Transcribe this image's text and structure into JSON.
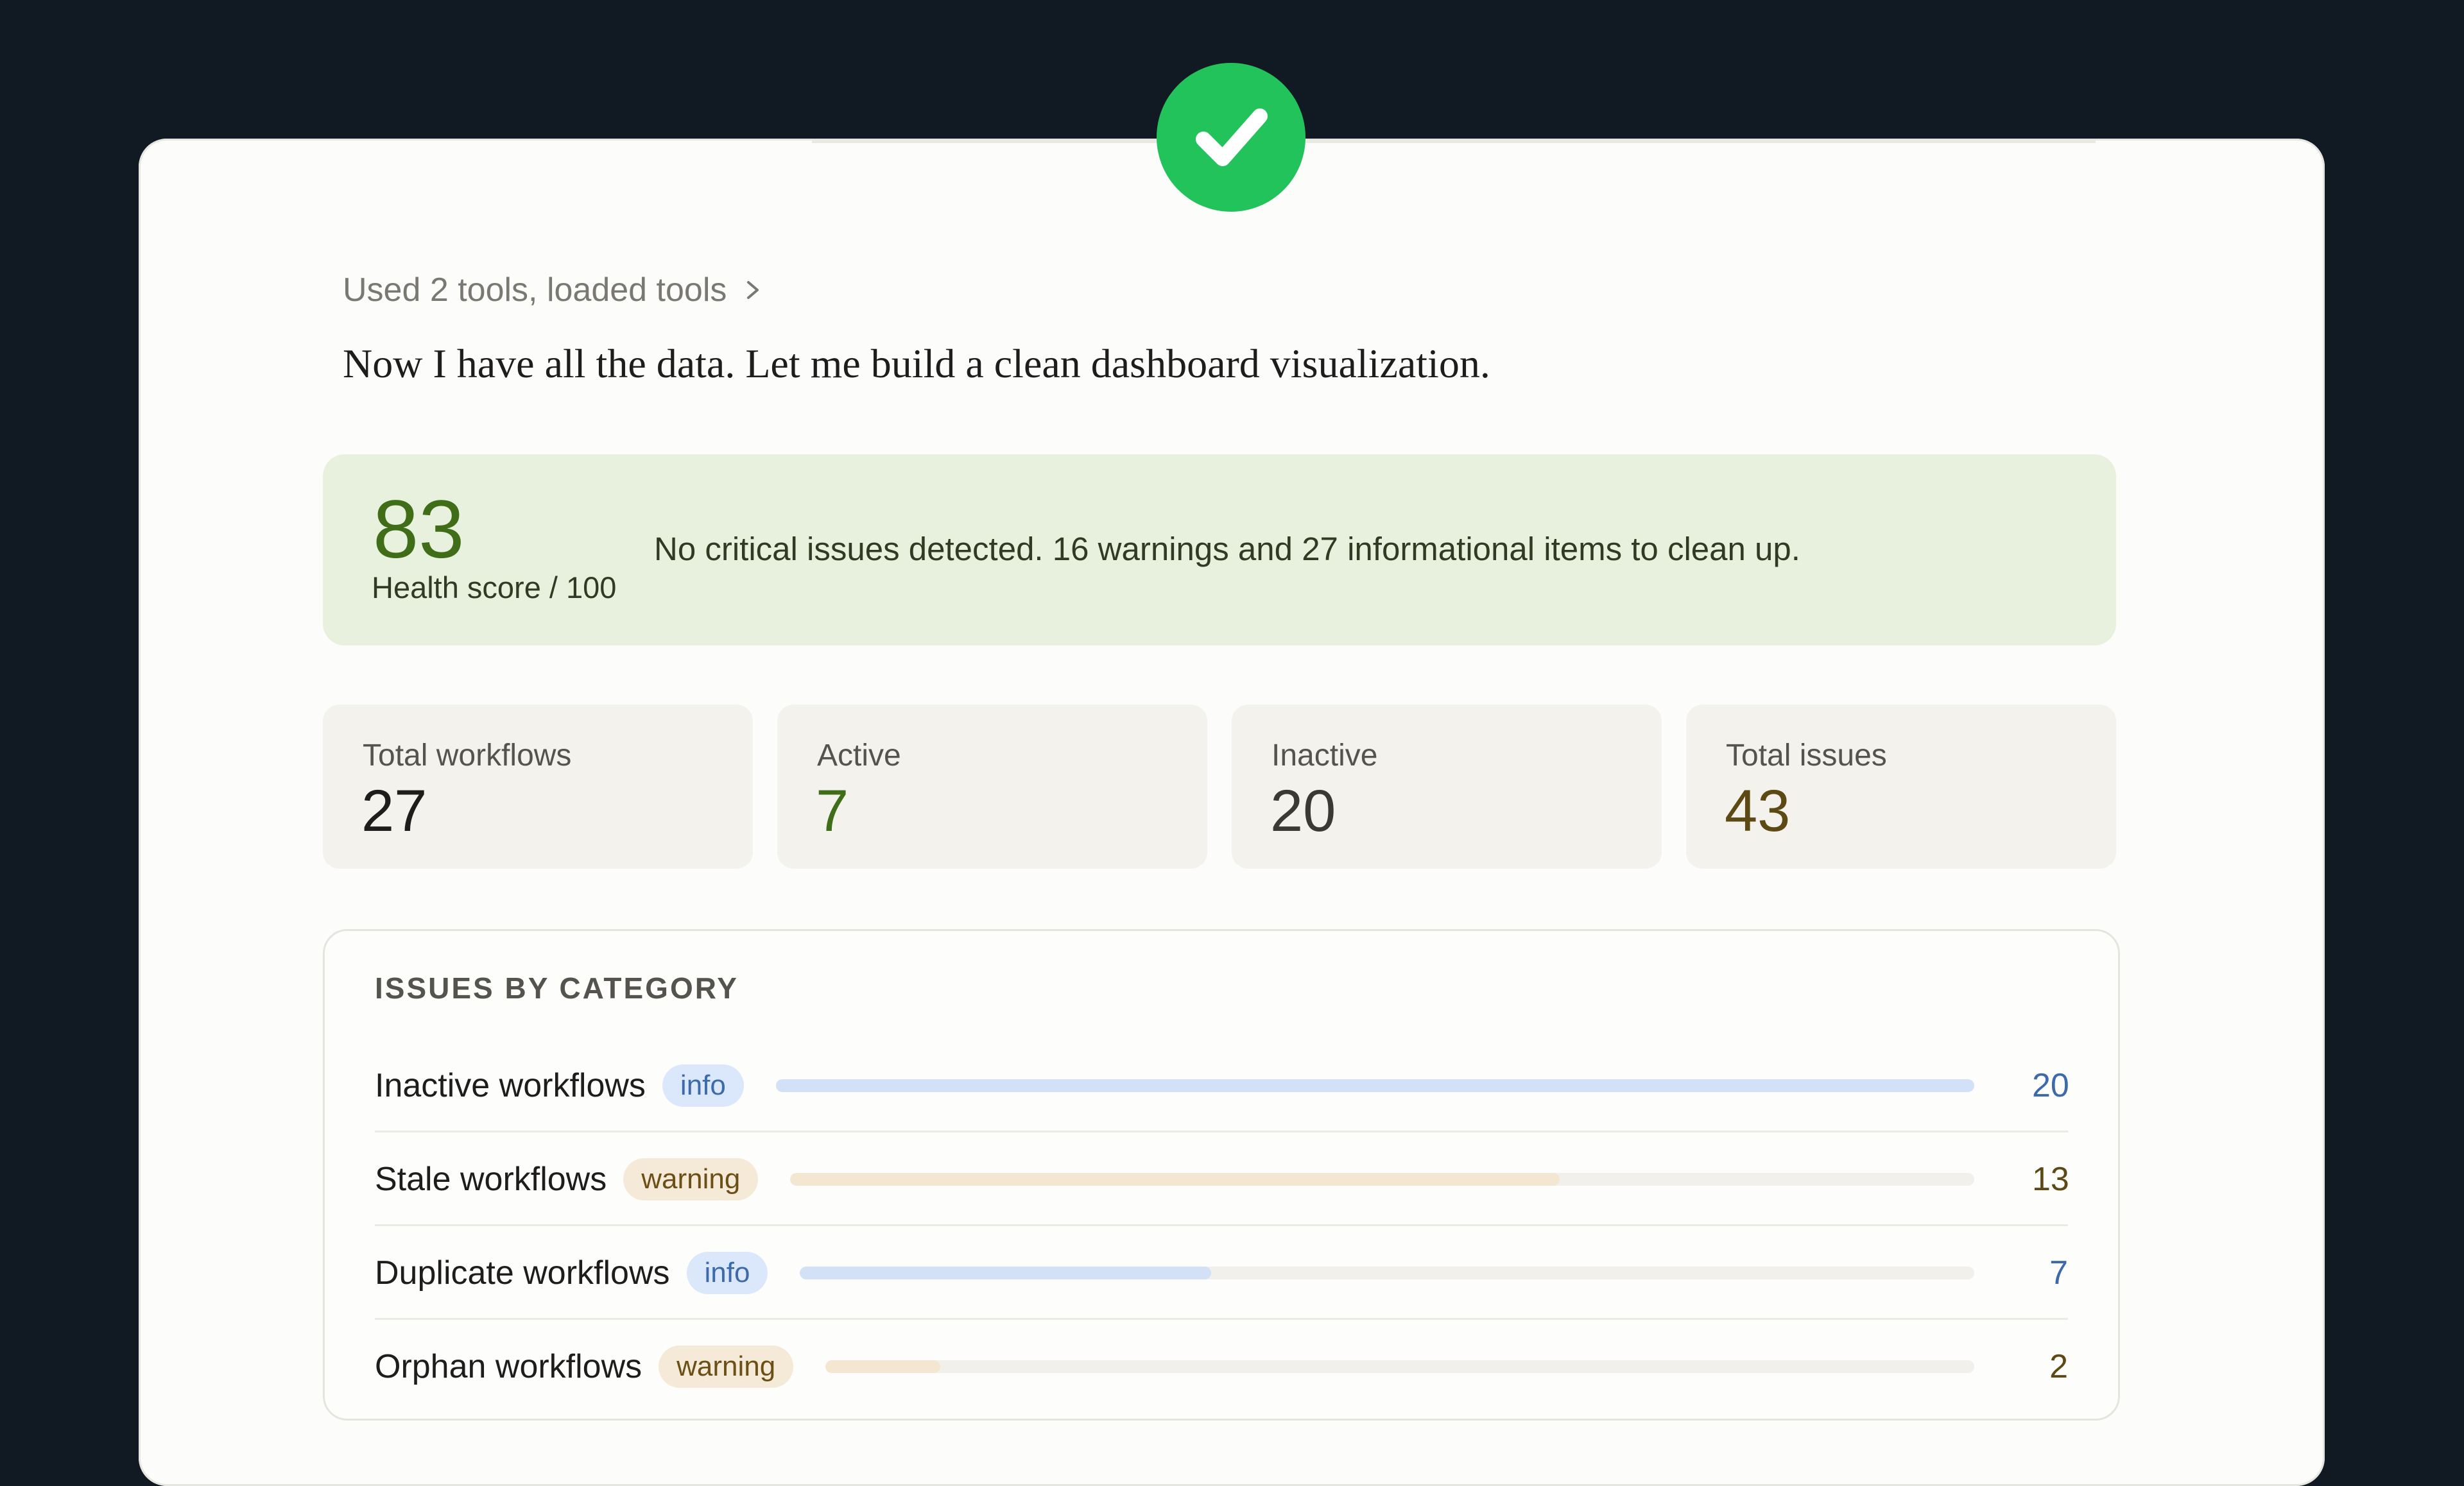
{
  "tools_summary": "Used 2 tools, loaded tools",
  "intro_text": "Now I have all the data. Let me build a clean dashboard visualization.",
  "health": {
    "score": "83",
    "label": "Health score / 100",
    "message": "No critical issues detected. 16 warnings and 27 informational items to clean up.",
    "score_value": 83
  },
  "stats": [
    {
      "label": "Total workflows",
      "value": "27",
      "color": "#1e1d1b"
    },
    {
      "label": "Active",
      "value": "7",
      "color": "#3f6d18"
    },
    {
      "label": "Inactive",
      "value": "20",
      "color": "#3a3935"
    },
    {
      "label": "Total issues",
      "value": "43",
      "color": "#5c4913"
    }
  ],
  "issues": {
    "title": "ISSUES BY CATEGORY",
    "rows": [
      {
        "label": "Inactive workflows",
        "badge": "info",
        "badge_type": "info",
        "count": "20",
        "fraction": 1.0,
        "count_color": "#3c6aab"
      },
      {
        "label": "Stale workflows",
        "badge": "warning",
        "badge_type": "warning",
        "count": "13",
        "fraction": 0.65,
        "count_color": "#5c4913"
      },
      {
        "label": "Duplicate workflows",
        "badge": "info",
        "badge_type": "info",
        "count": "7",
        "fraction": 0.35,
        "count_color": "#3c6aab"
      },
      {
        "label": "Orphan workflows",
        "badge": "warning",
        "badge_type": "warning",
        "count": "2",
        "fraction": 0.1,
        "count_color": "#5c4913"
      }
    ]
  },
  "icons": {
    "status": "check-circle-icon",
    "expand": "chevron-right-icon"
  }
}
